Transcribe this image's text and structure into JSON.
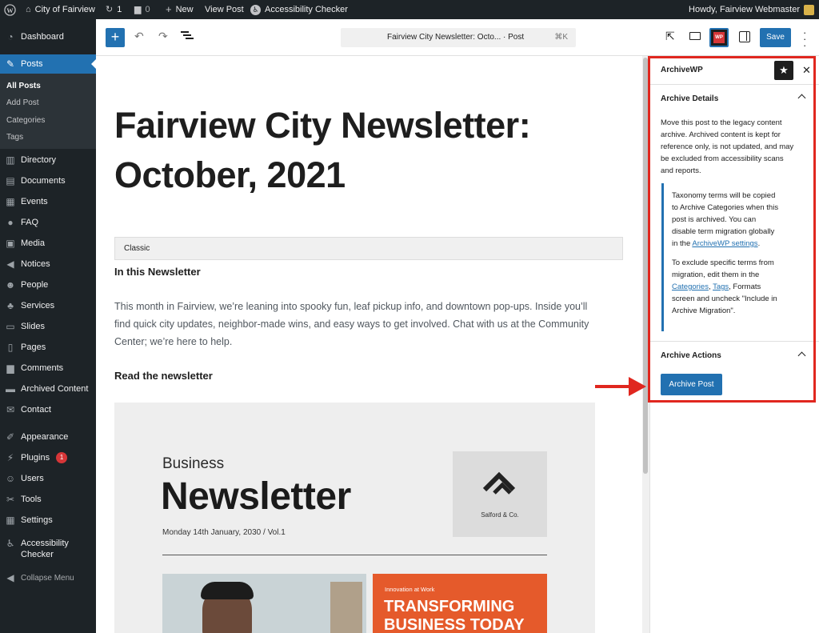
{
  "adminbar": {
    "site": "City of Fairview",
    "updates": "1",
    "comments": "0",
    "new": "New",
    "view_post": "View Post",
    "a11y": "Accessibility Checker",
    "howdy": "Howdy, Fairview Webmaster"
  },
  "sidebar": {
    "dashboard": "Dashboard",
    "posts": "Posts",
    "sub": [
      "All Posts",
      "Add Post",
      "Categories",
      "Tags"
    ],
    "items": [
      "Directory",
      "Documents",
      "Events",
      "FAQ",
      "Media",
      "Notices",
      "People",
      "Services",
      "Slides",
      "Pages",
      "Comments",
      "Archived Content",
      "Contact"
    ],
    "appearance": "Appearance",
    "plugins": "Plugins",
    "plugins_badge": "1",
    "users": "Users",
    "tools": "Tools",
    "settings": "Settings",
    "a11y1": "Accessibility",
    "a11y2": "Checker",
    "collapse": "Collapse Menu"
  },
  "toolbar": {
    "doc_title": "Fairview City Newsletter: Octo... · Post",
    "shortcut": "⌘K",
    "save": "Save",
    "wp_badge": "WP"
  },
  "post": {
    "title1": "Fairview City Newsletter:",
    "title2": "October, 2021",
    "classic": "Classic",
    "h_in": "In this Newsletter",
    "p1a": "This month in Fairview, we’re leaning into spooky fun, leaf pickup info, and downtown pop-ups. Inside you’ll",
    "p1b": "find quick city updates, neighbor-made wins, and easy ways to get involved. Chat with us at the Community",
    "p1c": "Center; we’re here to help.",
    "h_read": "Read the newsletter"
  },
  "newsletter": {
    "business": "Business",
    "newsletter": "Newsletter",
    "date": "Monday 14th January, 2030 / Vol.1",
    "logo": "Salford & Co.",
    "innov": "Innovation at Work",
    "transform1": "TRANSFORMING",
    "transform2": "BUSINESS TODAY"
  },
  "panel": {
    "title": "ArchiveWP",
    "details": "Archive Details",
    "d1": "Move this post to the legacy content",
    "d2": "archive. Archived content is kept for",
    "d3": "reference only, is not updated, and may",
    "d4": "be excluded from accessibility scans",
    "d5": "and reports.",
    "n1": "Taxonomy terms will be copied",
    "n2": "to Archive Categories when this",
    "n3": "post is archived. You can",
    "n4": "disable term migration globally",
    "n5": "in the ",
    "n5_link": "ArchiveWP settings",
    "m1": "To exclude specific terms from",
    "m2": "migration, edit them in the",
    "m3_cat": "Categories",
    "m3_tags": "Tags",
    "m3_rest": ", Formats",
    "m4": "screen and uncheck \"Include in",
    "m5": "Archive Migration\".",
    "actions": "Archive Actions",
    "archive_btn": "Archive Post"
  },
  "colors": {
    "accent": "#2271b1",
    "admin_bg": "#1d2327",
    "highlight": "#e0271f",
    "orange": "#e55a2b"
  }
}
